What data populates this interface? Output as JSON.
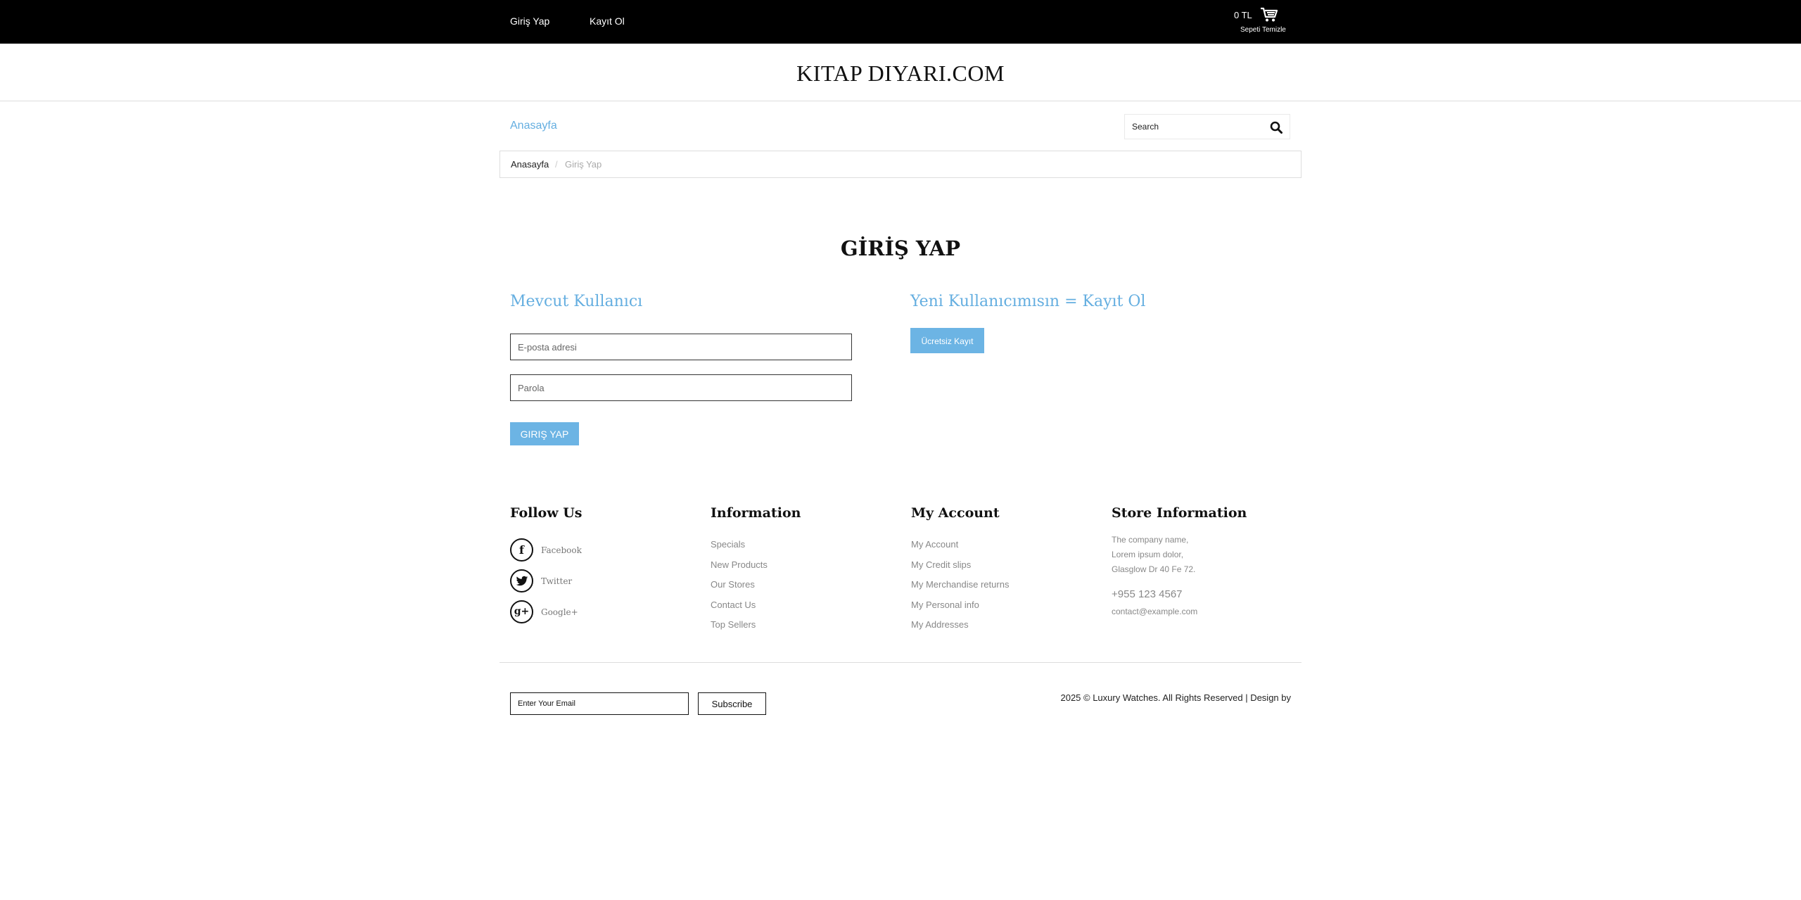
{
  "topbar": {
    "login_label": "Giriş Yap",
    "register_label": "Kayıt Ol",
    "cart_total": "0 TL",
    "cart_clear": "Sepeti Temizle"
  },
  "logo": "KITAP DIYARI.COM",
  "nav": {
    "home": "Anasayfa",
    "search_placeholder": "Search"
  },
  "breadcrumb": {
    "home": "Anasayfa",
    "separator": "/",
    "current": "Giriş Yap"
  },
  "login": {
    "title": "GİRİŞ YAP",
    "existing_heading": "Mevcut Kullanıcı",
    "email_placeholder": "E-posta adresi",
    "password_placeholder": "Parola",
    "submit_label": "GIRIŞ YAP",
    "new_heading": "Yeni Kullanıcımısın = Kayıt Ol",
    "register_label": "Ücretsiz Kayıt"
  },
  "footer": {
    "follow": {
      "heading": "Follow Us",
      "items": [
        {
          "label": "Facebook",
          "glyph": "f"
        },
        {
          "label": "Twitter",
          "glyph": "t"
        },
        {
          "label": "Google+",
          "glyph": "g+"
        }
      ]
    },
    "information": {
      "heading": "Information",
      "links": [
        "Specials",
        "New Products",
        "Our Stores",
        "Contact Us",
        "Top Sellers"
      ]
    },
    "account": {
      "heading": "My Account",
      "links": [
        "My Account",
        "My Credit slips",
        "My Merchandise returns",
        "My Personal info",
        "My Addresses"
      ]
    },
    "store": {
      "heading": "Store Information",
      "lines": [
        "The company name,",
        "Lorem ipsum dolor,",
        "Glasglow Dr 40 Fe 72."
      ],
      "phone": "+955 123 4567",
      "email": "contact@example.com"
    },
    "subscribe": {
      "email_placeholder": "Enter Your Email",
      "button_label": "Subscribe"
    },
    "copyright": "2025 © Luxury Watches. All Rights Reserved | Design by"
  },
  "colors": {
    "accent": "#64aee0",
    "button": "#6cb4e4",
    "topbar": "#000000"
  }
}
